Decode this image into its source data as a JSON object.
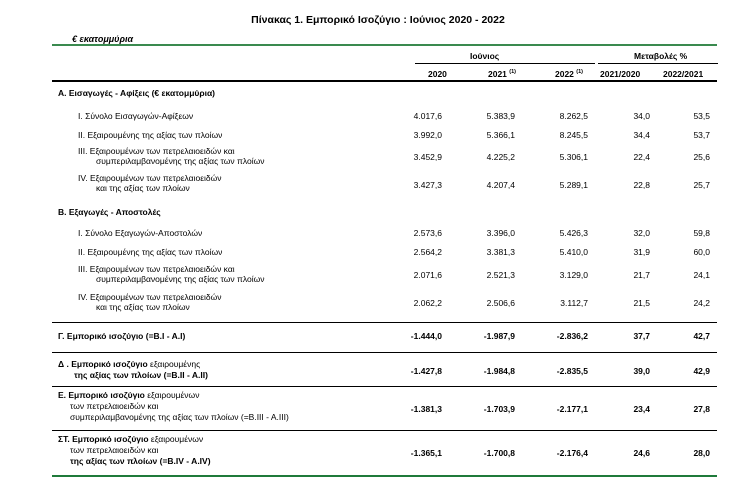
{
  "title": "Πίνακας 1. Εμπορικό Ισοζύγιο :  Ιούνιος 2020  - 2022",
  "unit": "€ εκατομμύρια",
  "header": {
    "group_june": "Ιούνιος",
    "group_changes": "Μεταβολές %",
    "col_2020": "2020",
    "col_2021": "2021",
    "col_2021_note": "(1)",
    "col_2022": "2022",
    "col_2022_note": "(1)",
    "col_chg_2021_2020": "2021/2020",
    "col_chg_2022_2021": "2022/2021"
  },
  "sections": {
    "a_title": "Α. Εισαγωγές - Αφίξεις (€ εκατομμύρια)",
    "b_title": "Β. Εξαγωγές - Αποστολές"
  },
  "rows": [
    {
      "label1": "I.  Σύνολο Εισαγωγών-Αφίξεων",
      "label2": "",
      "v2020": "4.017,6",
      "v2021": "5.383,9",
      "v2022": "8.262,5",
      "c1": "34,0",
      "c2": "53,5"
    },
    {
      "label1": "II.  Εξαιρουμένης  της αξίας των πλοίων",
      "label2": "",
      "v2020": "3.992,0",
      "v2021": "5.366,1",
      "v2022": "8.245,5",
      "c1": "34,4",
      "c2": "53,7"
    },
    {
      "label1": "III. Εξαιρουμένων των πετρελαιοειδών και",
      "label2": "συμπεριλαμβανομένης της αξίας των πλοίων",
      "v2020": "3.452,9",
      "v2021": "4.225,2",
      "v2022": "5.306,1",
      "c1": "22,4",
      "c2": "25,6"
    },
    {
      "label1": "IV. Εξαιρουμένων των πετρελαιοειδών",
      "label2": "και της αξίας των πλοίων",
      "v2020": "3.427,3",
      "v2021": "4.207,4",
      "v2022": "5.289,1",
      "c1": "22,8",
      "c2": "25,7"
    },
    {
      "label1": "I.  Σύνολο Εξαγωγών-Αποστολών",
      "label2": "",
      "v2020": "2.573,6",
      "v2021": "3.396,0",
      "v2022": "5.426,3",
      "c1": "32,0",
      "c2": "59,8"
    },
    {
      "label1": "II.  Εξαιρουμένης  της αξίας των πλοίων",
      "label2": "",
      "v2020": "2.564,2",
      "v2021": "3.381,3",
      "v2022": "5.410,0",
      "c1": "31,9",
      "c2": "60,0"
    },
    {
      "label1": "III. Εξαιρουμένων των πετρελαιοειδών και",
      "label2": "συμπεριλαμβανομένης της αξίας των πλοίων",
      "v2020": "2.071,6",
      "v2021": "2.521,3",
      "v2022": "3.129,0",
      "c1": "21,7",
      "c2": "24,1"
    },
    {
      "label1": "IV. Εξαιρουμένων των πετρελαιοειδών",
      "label2": "και της αξίας των πλοίων",
      "v2020": "2.062,2",
      "v2021": "2.506,6",
      "v2022": "3.112,7",
      "c1": "21,5",
      "c2": "24,2"
    }
  ],
  "balances": [
    {
      "bold1": "Γ. Εμπορικό ισοζύγιο (=B.I - A.I)",
      "rest1": "",
      "line2": "",
      "line3": "",
      "v2020": "-1.444,0",
      "v2021": "-1.987,9",
      "v2022": "-2.836,2",
      "c1": "37,7",
      "c2": "42,7"
    },
    {
      "bold1": "Δ . Εμπορικό ισοζύγιο",
      "rest1": " εξαιρουμένης",
      "line2": "της αξίας των πλοίων (=B.II - A.II)",
      "line3": "",
      "v2020": "-1.427,8",
      "v2021": "-1.984,8",
      "v2022": "-2.835,5",
      "c1": "39,0",
      "c2": "42,9"
    },
    {
      "bold1": "Ε. Εμπορικό ισοζύγιο",
      "rest1": " εξαιρουμένων",
      "line2": "των πετρελαιοειδών και",
      "line3": "συμπεριλαμβανομένης της αξίας των πλοίων (=B.III - A.III)",
      "v2020": "-1.381,3",
      "v2021": "-1.703,9",
      "v2022": "-2.177,1",
      "c1": "23,4",
      "c2": "27,8"
    },
    {
      "bold1": "ΣΤ. Εμπορικό ισοζύγιο",
      "rest1": " εξαιρουμένων",
      "line2": "των πετρελαιοειδών και",
      "line3": "της αξίας των πλοίων (=B.IV - A.IV)",
      "v2020": "-1.365,1",
      "v2021": "-1.700,8",
      "v2022": "-2.176,4",
      "c1": "24,6",
      "c2": "28,0"
    }
  ]
}
